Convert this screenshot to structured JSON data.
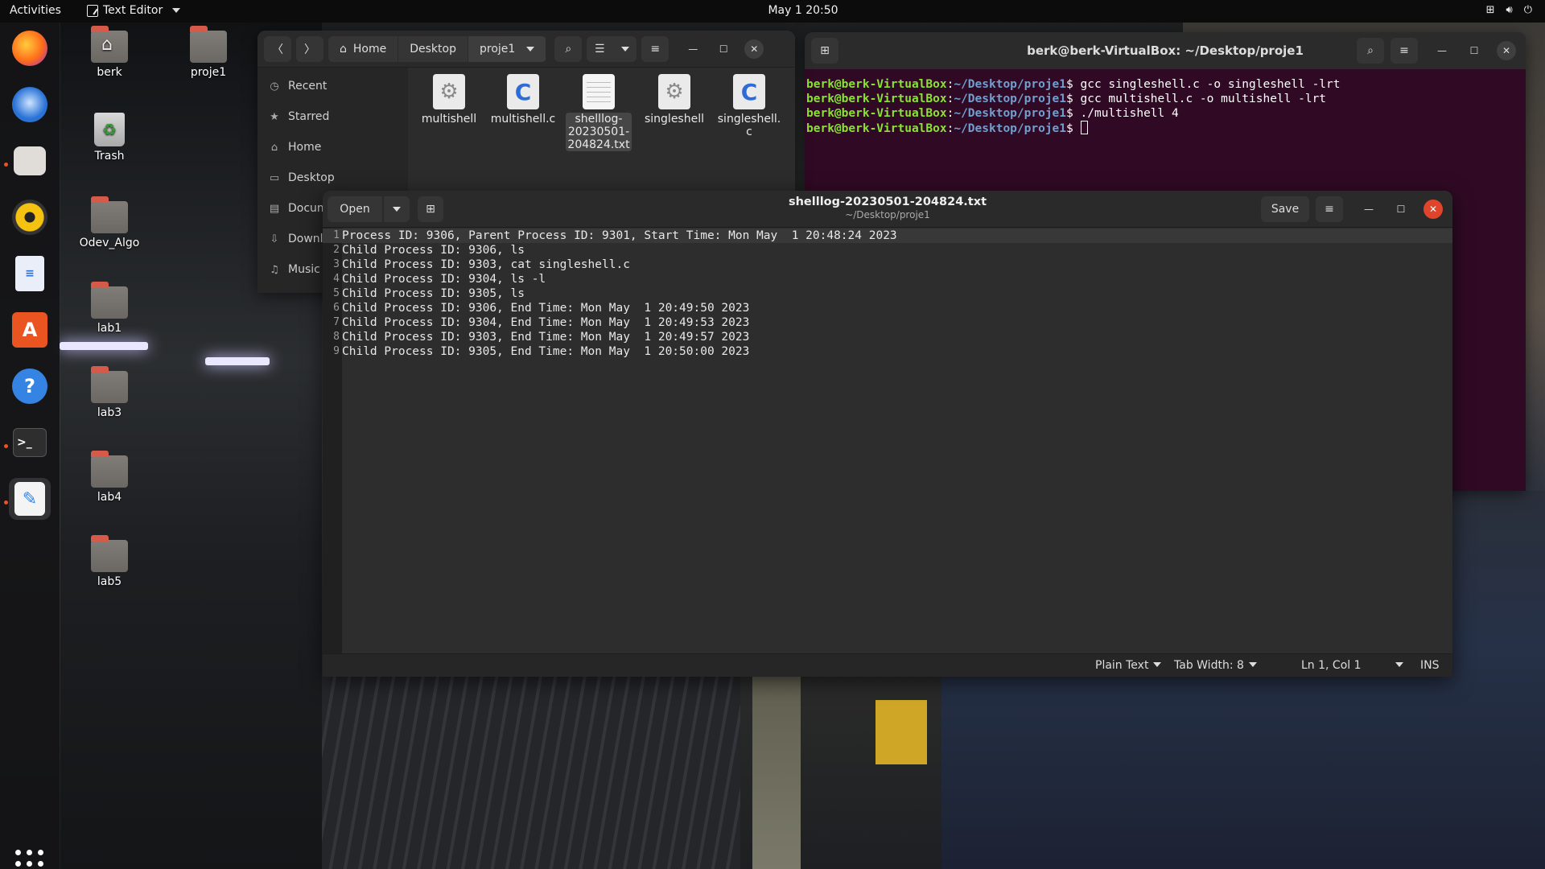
{
  "topbar": {
    "activities": "Activities",
    "app_name": "Text Editor",
    "clock": "May 1  20:50"
  },
  "desktop": {
    "icons": [
      "berk",
      "proje1",
      "Trash",
      "Odev_Algo",
      "lab1",
      "lab3",
      "lab4",
      "lab5"
    ]
  },
  "file_manager": {
    "path": [
      "Home",
      "Desktop",
      "proje1"
    ],
    "sidebar": [
      "Recent",
      "Starred",
      "Home",
      "Desktop",
      "Docum",
      "Downl",
      "Music"
    ],
    "files": [
      {
        "name": "multishell",
        "kind": "executable"
      },
      {
        "name": "multishell.c",
        "kind": "c-source"
      },
      {
        "name": "shelllog-\n20230501-\n204824.txt",
        "kind": "text"
      },
      {
        "name": "singleshell",
        "kind": "executable"
      },
      {
        "name": "singleshell.\nc",
        "kind": "c-source"
      }
    ]
  },
  "terminal": {
    "title": "berk@berk-VirtualBox: ~/Desktop/proje1",
    "prompt_user": "berk@berk-VirtualBox",
    "prompt_path": "~/Desktop/proje1",
    "commands": [
      "gcc singleshell.c -o singleshell -lrt",
      "gcc multishell.c -o multishell -lrt",
      "./multishell 4",
      ""
    ]
  },
  "editor": {
    "filename": "shelllog-20230501-204824.txt",
    "dir": "~/Desktop/proje1",
    "open_label": "Open",
    "save_label": "Save",
    "lines": [
      "Process ID: 9306, Parent Process ID: 9301, Start Time: Mon May  1 20:48:24 2023",
      "Child Process ID: 9306, ls",
      "Child Process ID: 9303, cat singleshell.c",
      "Child Process ID: 9304, ls -l",
      "Child Process ID: 9305, ls",
      "Child Process ID: 9306, End Time: Mon May  1 20:49:50 2023",
      "Child Process ID: 9304, End Time: Mon May  1 20:49:53 2023",
      "Child Process ID: 9303, End Time: Mon May  1 20:49:57 2023",
      "Child Process ID: 9305, End Time: Mon May  1 20:50:00 2023"
    ],
    "status": {
      "language": "Plain Text",
      "tab_width": "Tab Width: 8",
      "position": "Ln 1, Col 1",
      "mode": "INS"
    }
  },
  "colors": {
    "terminal_bg": "#300a24",
    "prompt_user": "#8ae234",
    "prompt_path": "#729fcf",
    "accent": "#e95420"
  }
}
